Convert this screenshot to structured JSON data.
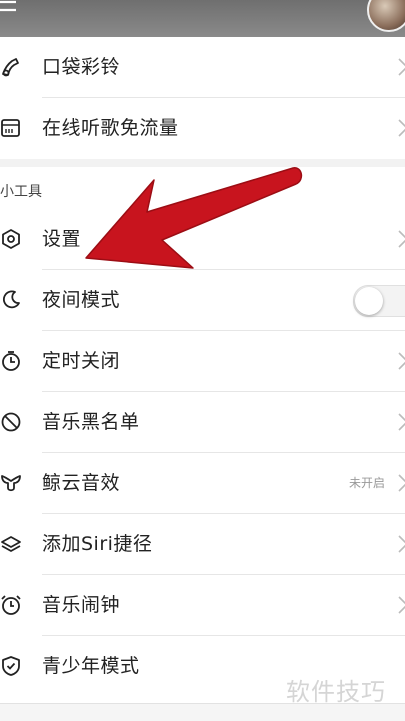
{
  "items_top": [
    {
      "icon": "ringtone-icon",
      "label": "口袋彩铃"
    },
    {
      "icon": "sim-card-icon",
      "label": "在线听歌免流量"
    }
  ],
  "section_title": "小工具",
  "items_tools": [
    {
      "icon": "settings-icon",
      "label": "设置"
    },
    {
      "icon": "moon-icon",
      "label": "夜间模式"
    },
    {
      "icon": "timer-icon",
      "label": "定时关闭"
    },
    {
      "icon": "blocked-icon",
      "label": "音乐黑名单"
    },
    {
      "icon": "whale-icon",
      "label": "鲸云音效",
      "status": "未开启"
    },
    {
      "icon": "layers-icon",
      "label": "添加Siri捷径"
    },
    {
      "icon": "alarm-icon",
      "label": "音乐闹钟"
    },
    {
      "icon": "shield-icon",
      "label": "青少年模式"
    }
  ],
  "night_mode_on": false,
  "watermark": "软件技巧",
  "colors": {
    "arrow": "#c8141e",
    "separator": "#e6e6e6",
    "gap": "#f2f2f2"
  }
}
